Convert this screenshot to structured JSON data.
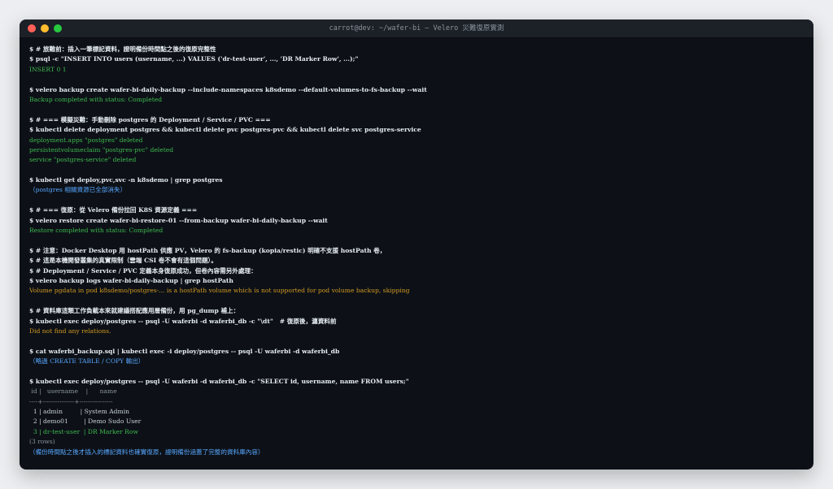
{
  "window": {
    "title": "carrot@dev: ~/wafer-bi — Velero 災難復原實測"
  },
  "terminal": {
    "lines": [
      {
        "type": "cmd",
        "text": "$ # 旅難前：插入一筆標記資料，證明備份時間點之後的復原完整性"
      },
      {
        "type": "cmd",
        "text": "$ psql -c \"INSERT INTO users (username, ...) VALUES ('dr-test-user', ..., 'DR Marker Row', ...);\""
      },
      {
        "type": "ok",
        "text": "INSERT 0 1"
      },
      {
        "type": "blank",
        "text": ""
      },
      {
        "type": "cmd",
        "text": "$ velero backup create wafer-bi-daily-backup --include-namespaces k8sdemo --default-volumes-to-fs-backup --wait"
      },
      {
        "type": "ok",
        "text": "Backup completed with status: Completed"
      },
      {
        "type": "blank",
        "text": ""
      },
      {
        "type": "cmd",
        "text": "$ # === 模擬災難：手動刪除 postgres 的 Deployment / Service / PVC ==="
      },
      {
        "type": "cmd",
        "text": "$ kubectl delete deployment postgres && kubectl delete pvc postgres-pvc && kubectl delete svc postgres-service"
      },
      {
        "type": "ok",
        "text": "deployment.apps \"postgres\" deleted"
      },
      {
        "type": "ok",
        "text": "persistentvolumeclaim \"postgres-pvc\" deleted"
      },
      {
        "type": "ok",
        "text": "service \"postgres-service\" deleted"
      },
      {
        "type": "blank",
        "text": ""
      },
      {
        "type": "cmd",
        "text": "$ kubectl get deploy,pvc,svc -n k8sdemo | grep postgres"
      },
      {
        "type": "info",
        "text": "（postgres 相關資源已全部消失）"
      },
      {
        "type": "blank",
        "text": ""
      },
      {
        "type": "cmd",
        "text": "$ # === 復原：從 Velero 備份拉回 K8S 資源定義 ==="
      },
      {
        "type": "cmd",
        "text": "$ velero restore create wafer-bi-restore-01 --from-backup wafer-bi-daily-backup --wait"
      },
      {
        "type": "ok",
        "text": "Restore completed with status: Completed"
      },
      {
        "type": "blank",
        "text": ""
      },
      {
        "type": "cmd",
        "text": "$ # 注意：Docker Desktop 用 hostPath 供應 PV，Velero 的 fs-backup (kopia/restic) 明確不支援 hostPath 卷，"
      },
      {
        "type": "cmd",
        "text": "$ # 這是本機開發叢集的真實限制（雲端 CSI 卷不會有這個問題）。"
      },
      {
        "type": "cmd",
        "text": "$ # Deployment / Service / PVC 定義本身復原成功，但卷內容需另外處理："
      },
      {
        "type": "cmd",
        "text": "$ velero backup logs wafer-bi-daily-backup | grep hostPath"
      },
      {
        "type": "warn",
        "text": "Volume pgdata in pod k8sdemo/postgres-... is a hostPath volume which is not supported for pod volume backup, skipping"
      },
      {
        "type": "blank",
        "text": ""
      },
      {
        "type": "cmd",
        "text": "$ # 資料庫這類工作負載本來就建議搭配應用層備份，用 pg_dump 補上："
      },
      {
        "type": "cmd",
        "text": "$ kubectl exec deploy/postgres -- psql -U waferbi -d waferbi_db -c \"\\dt\"   # 復原後，瀍資料前"
      },
      {
        "type": "warn",
        "text": "Did not find any relations."
      },
      {
        "type": "blank",
        "text": ""
      },
      {
        "type": "cmd",
        "text": "$ cat waferbi_backup.sql | kubectl exec -i deploy/postgres -- psql -U waferbi -d waferbi_db"
      },
      {
        "type": "info",
        "text": "（略過 CREATE TABLE / COPY 輸出）"
      },
      {
        "type": "blank",
        "text": ""
      },
      {
        "type": "cmd",
        "text": "$ kubectl exec deploy/postgres -- psql -U waferbi -d waferbi_db -c \"SELECT id, username, name FROM users;\""
      },
      {
        "type": "muted",
        "text": " id |   username    |      name"
      },
      {
        "type": "muted",
        "text": "----+---------------+----------------"
      },
      {
        "type": "plain",
        "text": "  1 | admin         | System Admin"
      },
      {
        "type": "plain",
        "text": "  2 | demo01        | Demo Sudo User"
      },
      {
        "type": "ok",
        "text": "  3 | dr-test-user  | DR Marker Row"
      },
      {
        "type": "muted",
        "text": "(3 rows)"
      },
      {
        "type": "info",
        "text": "（備份時間點之後才插入的標記資料也確實復原，證明備份涵蓋了完整的資料庫內容）"
      }
    ]
  }
}
